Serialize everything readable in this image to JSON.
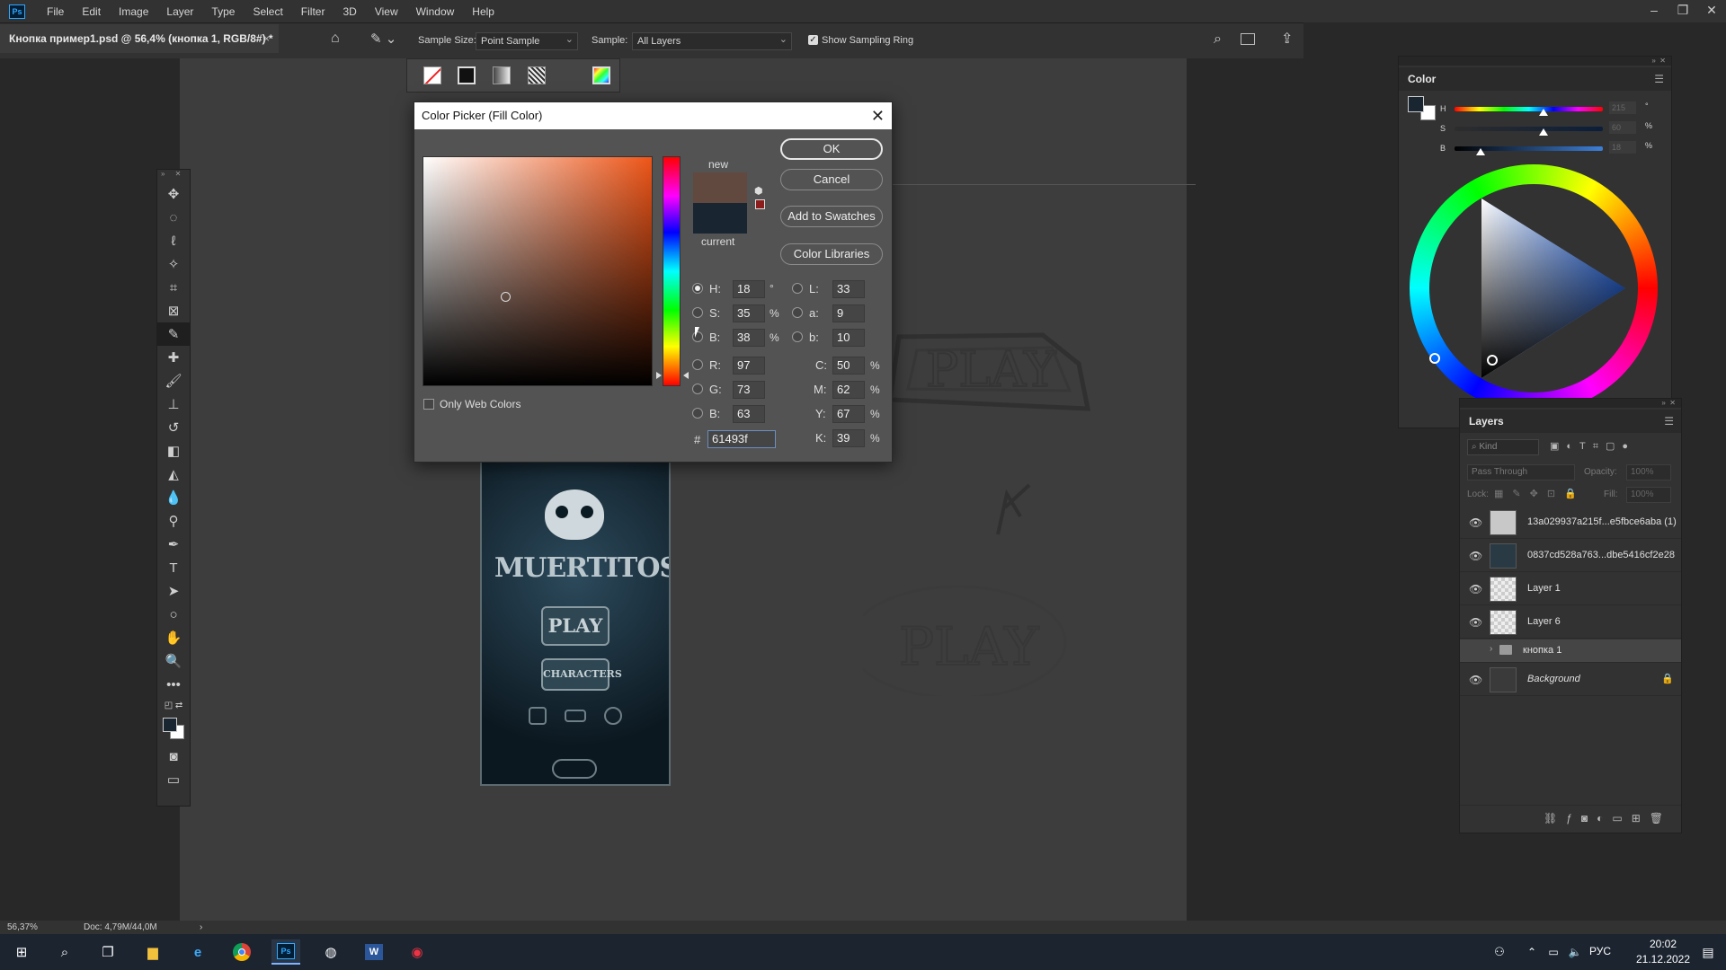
{
  "app": {
    "logo": "Ps",
    "menu": [
      "File",
      "Edit",
      "Image",
      "Layer",
      "Type",
      "Select",
      "Filter",
      "3D",
      "View",
      "Window",
      "Help"
    ],
    "window_controls": [
      "–",
      "❐",
      "✕"
    ]
  },
  "document_tab": {
    "title": "Кнопка пример1.psd @ 56,4% (кнопка 1, RGB/8#) *",
    "close": "×"
  },
  "options_bar": {
    "sample_size_label": "Sample Size:",
    "sample_size_value": "Point Sample",
    "sample_label": "Sample:",
    "sample_value": "All Layers",
    "show_sampling_ring_label": "Show Sampling Ring",
    "show_sampling_ring_checked": true
  },
  "color_picker": {
    "title": "Color Picker (Fill Color)",
    "new_label": "new",
    "current_label": "current",
    "new_color": "#61493f",
    "current_color": "#1a2532",
    "buttons": {
      "ok": "OK",
      "cancel": "Cancel",
      "add_to_swatches": "Add to Swatches",
      "color_libraries": "Color Libraries"
    },
    "hsb": [
      {
        "label": "H:",
        "value": "18",
        "unit": "°",
        "selected": true
      },
      {
        "label": "S:",
        "value": "35",
        "unit": "%",
        "selected": false
      },
      {
        "label": "B:",
        "value": "38",
        "unit": "%",
        "selected": false
      }
    ],
    "rgb": [
      {
        "label": "R:",
        "value": "97"
      },
      {
        "label": "G:",
        "value": "73"
      },
      {
        "label": "B:",
        "value": "63"
      }
    ],
    "lab": [
      {
        "label": "L:",
        "value": "33"
      },
      {
        "label": "a:",
        "value": "9"
      },
      {
        "label": "b:",
        "value": "10"
      }
    ],
    "cmyk": [
      {
        "label": "C:",
        "value": "50",
        "unit": "%"
      },
      {
        "label": "M:",
        "value": "62",
        "unit": "%"
      },
      {
        "label": "Y:",
        "value": "67",
        "unit": "%"
      },
      {
        "label": "K:",
        "value": "39",
        "unit": "%"
      }
    ],
    "hex_label": "#",
    "hex_value": "61493f",
    "only_web_colors_label": "Only Web Colors",
    "only_web_colors_checked": false
  },
  "color_panel": {
    "title": "Color",
    "sliders": [
      {
        "label": "H",
        "value": "215",
        "unit": "°"
      },
      {
        "label": "S",
        "value": "60",
        "unit": "%"
      },
      {
        "label": "B",
        "value": "18",
        "unit": "%"
      }
    ]
  },
  "layers_panel": {
    "title": "Layers",
    "search_placeholder": "Kind",
    "blend_mode": "Pass Through",
    "opacity_label": "Opacity:",
    "opacity_value": "100%",
    "lock_label": "Lock:",
    "fill_label": "Fill:",
    "fill_value": "100%",
    "layers": [
      {
        "name": "13a029937a215f...e5fbce6aba (1)",
        "visible": true,
        "kind": "smart"
      },
      {
        "name": "0837cd528a763...dbe5416cf2e28",
        "visible": true,
        "kind": "smart"
      },
      {
        "name": "Layer 1",
        "visible": true,
        "kind": "pixel"
      },
      {
        "name": "Layer 6",
        "visible": true,
        "kind": "pixel"
      },
      {
        "name": "кнопка 1",
        "visible": false,
        "kind": "group"
      },
      {
        "name": "Background",
        "visible": true,
        "kind": "background"
      }
    ]
  },
  "artwork": {
    "game_title": "MUERTITOS",
    "play": "PLAY",
    "characters": "CHARACTERS",
    "sketch_play": "PLAY"
  },
  "status_bar": {
    "zoom": "56,37%",
    "doc": "Doc: 4,79M/44,0M"
  },
  "taskbar": {
    "language": "РУС",
    "time": "20:02",
    "date": "21.12.2022"
  }
}
